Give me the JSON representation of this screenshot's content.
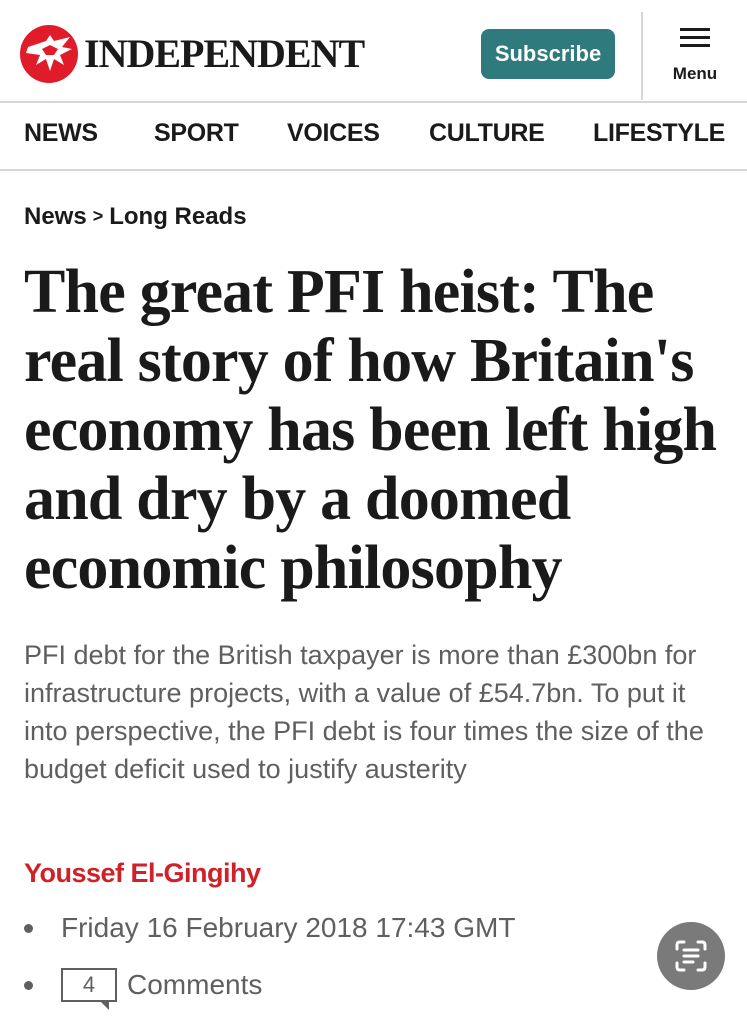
{
  "header": {
    "brand": "INDEPENDENT",
    "subscribe_label": "Subscribe",
    "menu_label": "Menu",
    "logo_icon": "eagle-icon",
    "brand_color": "#e11c2a",
    "subscribe_color": "#2f7a7d"
  },
  "nav": {
    "items": [
      {
        "label": "NEWS"
      },
      {
        "label": "SPORT"
      },
      {
        "label": "VOICES"
      },
      {
        "label": "CULTURE"
      },
      {
        "label": "LIFESTYLE"
      }
    ]
  },
  "breadcrumb": {
    "items": [
      "News",
      "Long Reads"
    ],
    "separator": ">"
  },
  "article": {
    "headline": "The great PFI heist: The real story of how Britain's economy has been left high and dry by a doomed economic philosophy",
    "standfirst": "PFI debt for the British taxpayer is more than £300bn for infrastructure projects, with a value of £54.7bn. To put it into perspective, the PFI debt is four times the size of the budget deficit used to justify austerity",
    "author": "Youssef El-Gingihy",
    "author_color": "#d02028",
    "date": "Friday 16 February 2018 17:43 GMT",
    "comment_count": "4",
    "comments_label": "Comments"
  },
  "fab": {
    "icon": "text-scan-icon"
  }
}
